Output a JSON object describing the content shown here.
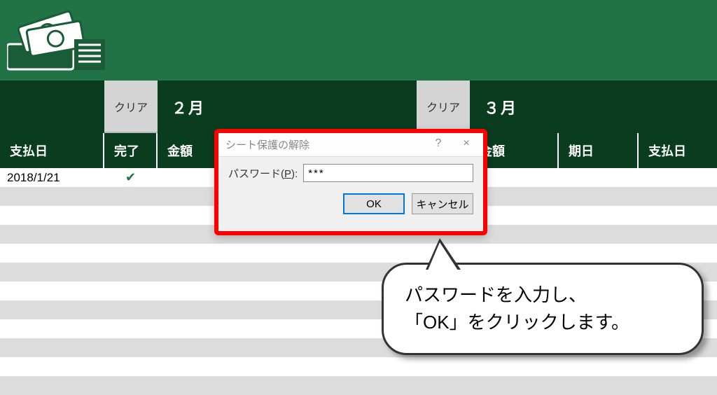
{
  "header": {
    "icon_name": "money-bills-icon"
  },
  "months": {
    "clear_label": "クリア",
    "month_feb": "２月",
    "month_mar": "３月"
  },
  "columns": {
    "pay_date": "支払日",
    "done": "完了",
    "amount": "金額",
    "due_date": "期日"
  },
  "rows": [
    {
      "pay_date": "2018/1/21",
      "done": true
    }
  ],
  "dialog": {
    "title": "シート保護の解除",
    "help": "?",
    "close": "×",
    "password_label_pre": "パスワード(",
    "password_label_u": "P",
    "password_label_post": "):",
    "password_value": "***",
    "ok": "OK",
    "cancel": "キャンセル"
  },
  "callout": {
    "line1": "パスワードを入力し、",
    "line2": "「OK」をクリックします。"
  }
}
